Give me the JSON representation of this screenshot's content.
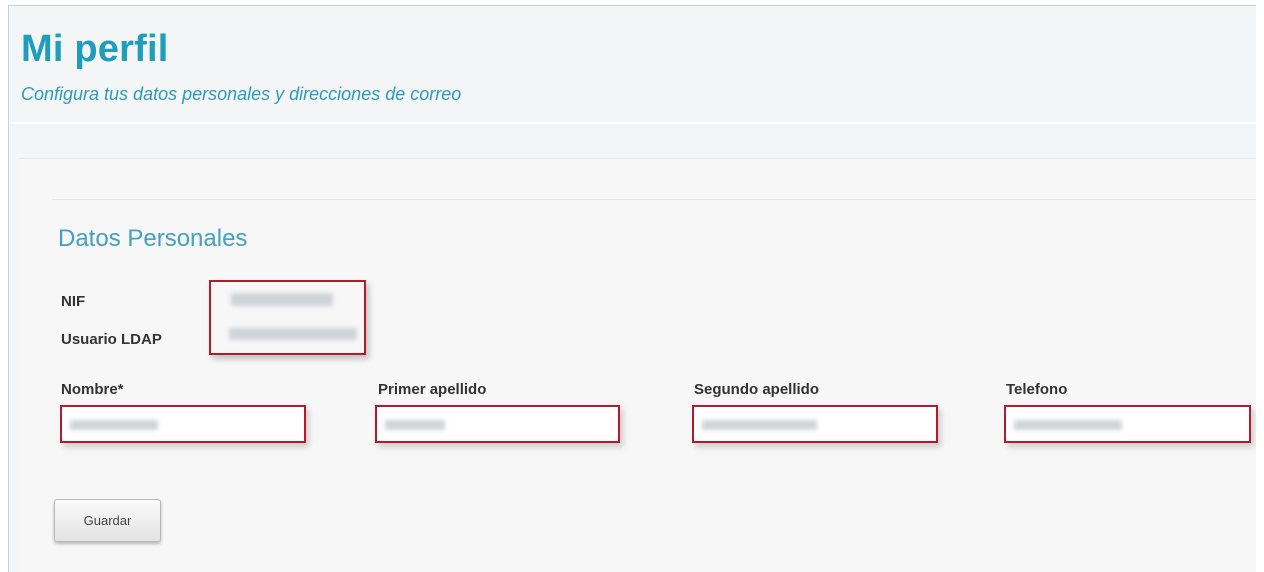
{
  "header": {
    "title": "Mi perfil",
    "subtitle": "Configura tus datos personales y direcciones de correo"
  },
  "section": {
    "title": "Datos Personales"
  },
  "info": {
    "nif_label": "NIF",
    "nif_value": "",
    "ldap_label": "Usuario LDAP",
    "ldap_value": ""
  },
  "form": {
    "nombre_label": "Nombre*",
    "nombre_value": "",
    "primer_apellido_label": "Primer apellido",
    "primer_apellido_value": "",
    "segundo_apellido_label": "Segundo apellido",
    "segundo_apellido_value": "",
    "telefono_label": "Telefono",
    "telefono_value": ""
  },
  "actions": {
    "save_label": "Guardar"
  },
  "colors": {
    "accent": "#1e9dbd",
    "highlight_border": "#b01c2e"
  }
}
